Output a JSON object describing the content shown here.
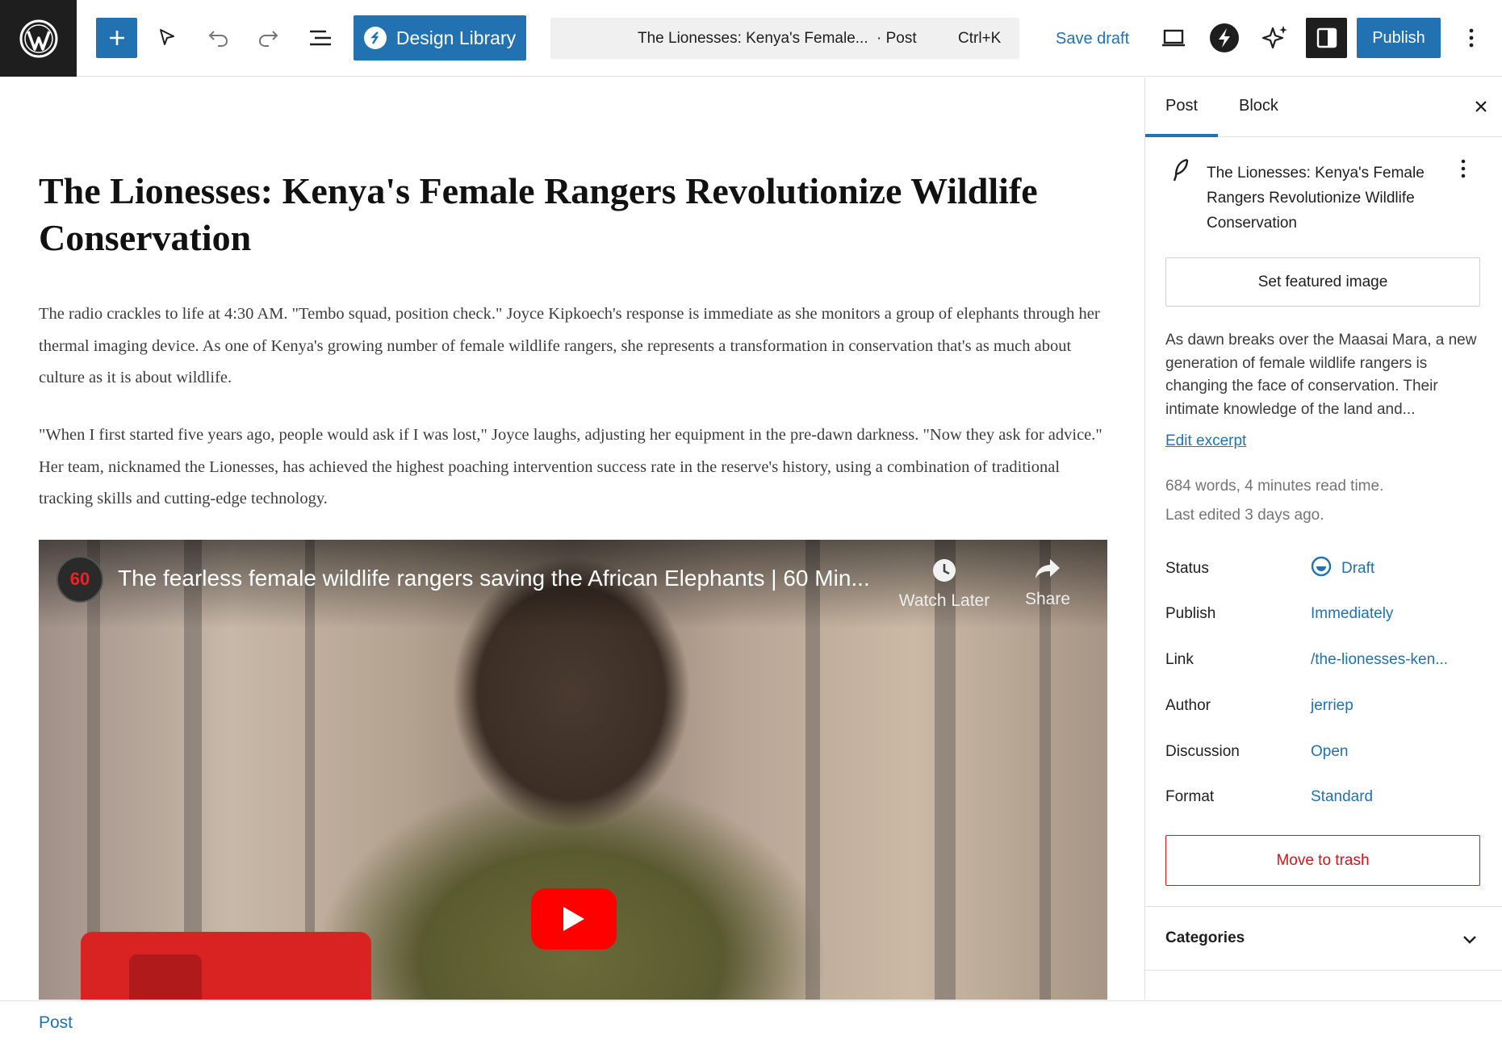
{
  "toolbar": {
    "design_library_label": "Design Library",
    "command_title": "The Lionesses: Kenya's Female...",
    "command_type": "· Post",
    "command_shortcut": "Ctrl+K",
    "save_draft_label": "Save draft",
    "publish_label": "Publish"
  },
  "icons": {
    "logo": "wordpress-icon",
    "inserter": "plus-icon",
    "tools": "select-arrow-icon",
    "undo": "undo-icon",
    "redo": "redo-icon",
    "outline": "list-view-icon",
    "preview": "laptop-icon",
    "plugin": "bolt-icon",
    "ai": "sparkle-icon",
    "settings": "sidebar-toggle-icon",
    "options": "more-vertical-icon"
  },
  "post": {
    "title": "The Lionesses: Kenya's Female Rangers Revolutionize Wildlife Conservation",
    "paragraphs": [
      "The radio crackles to life at 4:30 AM. \"Tembo squad, position check.\" Joyce Kipkoech's response is immediate as she monitors a group of elephants through her thermal imaging device. As one of Kenya's growing number of female wildlife rangers, she represents a transformation in conservation that's as much about culture as it is about wildlife.",
      "\"When I first started five years ago, people would ask if I was lost,\" Joyce laughs, adjusting her equipment in the pre-dawn darkness. \"Now they ask for advice.\" Her team, nicknamed the Lionesses, has achieved the highest poaching intervention success rate in the reserve's history, using a combination of traditional tracking skills and cutting-edge technology."
    ],
    "video": {
      "channel_badge": "60",
      "title": "The fearless female wildlife rangers saving the African Elephants | 60 Min...",
      "watch_later_label": "Watch Later",
      "share_label": "Share"
    }
  },
  "footer": {
    "breadcrumb": "Post"
  },
  "sidebar": {
    "tabs": [
      "Post",
      "Block"
    ],
    "summary_title": "The Lionesses: Kenya's Female Rangers Revolutionize Wildlife Conservation",
    "featured_image_label": "Set featured image",
    "excerpt": "As dawn breaks over the Maasai Mara, a new generation of female wildlife rangers is changing the face of conservation. Their intimate knowledge of the land and...",
    "edit_excerpt_label": "Edit excerpt",
    "word_count": "684 words, 4 minutes read time.",
    "last_edited": "Last edited 3 days ago.",
    "properties": [
      {
        "label": "Status",
        "value": "Draft"
      },
      {
        "label": "Publish",
        "value": "Immediately"
      },
      {
        "label": "Link",
        "value": "/the-lionesses-ken..."
      },
      {
        "label": "Author",
        "value": "jerriep"
      },
      {
        "label": "Discussion",
        "value": "Open"
      },
      {
        "label": "Format",
        "value": "Standard"
      }
    ],
    "trash_label": "Move to trash",
    "categories_label": "Categories"
  },
  "colors": {
    "accent": "#2271b1",
    "danger": "#cc1818",
    "dark": "#1e1e1e"
  }
}
